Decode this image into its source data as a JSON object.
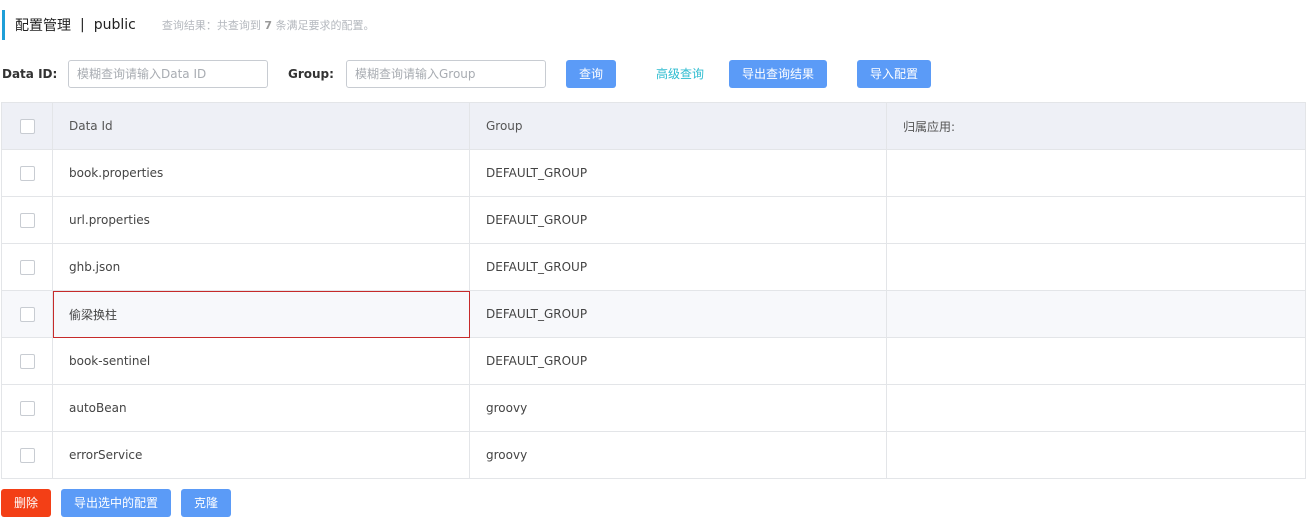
{
  "header": {
    "title": "配置管理",
    "separator": "|",
    "namespace": "public",
    "result_prefix": "查询结果：共查询到",
    "result_count": "7",
    "result_suffix": "条满足要求的配置。"
  },
  "search": {
    "data_id_label": "Data ID:",
    "data_id_placeholder": "模糊查询请输入Data ID",
    "group_label": "Group:",
    "group_placeholder": "模糊查询请输入Group",
    "query_button": "查询",
    "advanced_link": "高级查询",
    "export_button": "导出查询结果",
    "import_button": "导入配置"
  },
  "table": {
    "headers": [
      "Data Id",
      "Group",
      "归属应用:"
    ],
    "rows": [
      {
        "data_id": "book.properties",
        "group": "DEFAULT_GROUP",
        "app": ""
      },
      {
        "data_id": "url.properties",
        "group": "DEFAULT_GROUP",
        "app": ""
      },
      {
        "data_id": "ghb.json",
        "group": "DEFAULT_GROUP",
        "app": ""
      },
      {
        "data_id": "偷梁换柱",
        "group": "DEFAULT_GROUP",
        "app": ""
      },
      {
        "data_id": "book-sentinel",
        "group": "DEFAULT_GROUP",
        "app": ""
      },
      {
        "data_id": "autoBean",
        "group": "groovy",
        "app": ""
      },
      {
        "data_id": "errorService",
        "group": "groovy",
        "app": ""
      }
    ]
  },
  "footer": {
    "delete_button": "删除",
    "export_selected_button": "导出选中的配置",
    "clone_button": "克隆"
  },
  "colors": {
    "accent": "#1f9fd8",
    "primary_button": "#5b9bf7",
    "danger_button": "#f33f16",
    "link": "#2ebcd0",
    "selection_outline": "#c62a2a"
  }
}
